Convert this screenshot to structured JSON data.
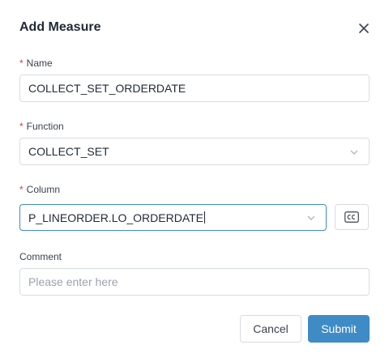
{
  "dialog": {
    "title": "Add Measure",
    "close_icon": "close-icon"
  },
  "fields": {
    "name": {
      "required_mark": "*",
      "label": "Name",
      "value": "COLLECT_SET_ORDERDATE"
    },
    "function": {
      "required_mark": "*",
      "label": "Function",
      "value": "COLLECT_SET",
      "icon": "chevron-down-icon"
    },
    "column": {
      "required_mark": "*",
      "label": "Column",
      "value": "P_LINEORDER.LO_ORDERDATE",
      "icon": "chevron-down-icon",
      "cc_icon": "cc-icon"
    },
    "comment": {
      "label": "Comment",
      "placeholder": "Please enter here",
      "value": ""
    }
  },
  "buttons": {
    "cancel": "Cancel",
    "submit": "Submit"
  },
  "colors": {
    "primary": "#3e8bc6",
    "required": "#e0393e",
    "border": "#d7dce3",
    "text": "#1f2a37"
  }
}
